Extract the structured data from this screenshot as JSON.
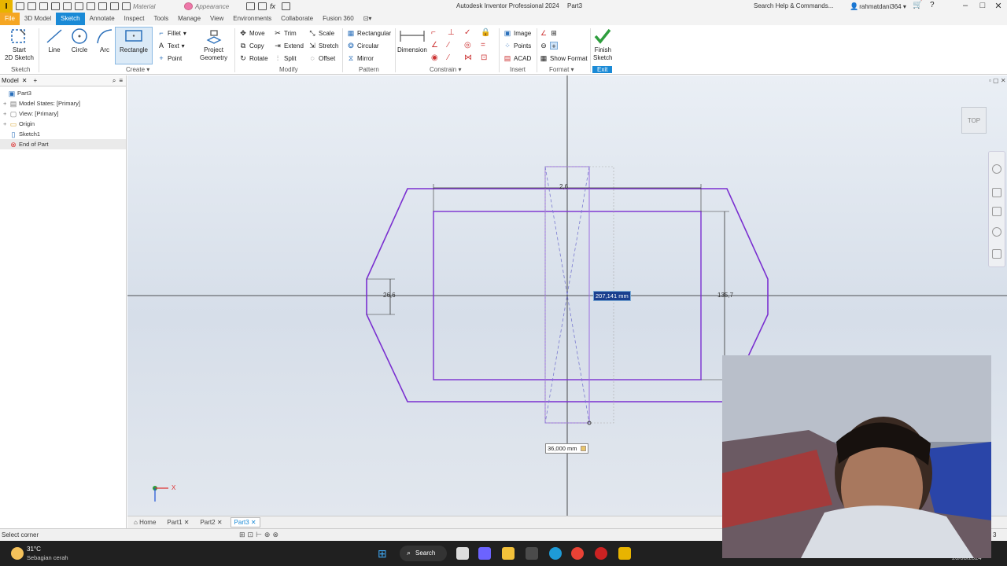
{
  "app": {
    "title": "Autodesk Inventor Professional 2024",
    "doc": "Part3",
    "logo": "I",
    "search_placeholder": "Search Help & Commands...",
    "user": "rahmatdani364",
    "material": "Material",
    "appearance": "Appearance"
  },
  "menu_tabs": [
    "File",
    "3D Model",
    "Sketch",
    "Annotate",
    "Inspect",
    "Tools",
    "Manage",
    "View",
    "Environments",
    "Collaborate",
    "Fusion 360"
  ],
  "ribbon": {
    "start_sketch": "Start\n2D Sketch",
    "line": "Line",
    "circle": "Circle",
    "arc": "Arc",
    "rectangle": "Rectangle",
    "fillet": "Fillet",
    "text": "Text",
    "point": "Point",
    "project_geometry": "Project\nGeometry",
    "move": "Move",
    "copy": "Copy",
    "rotate": "Rotate",
    "trim": "Trim",
    "extend": "Extend",
    "split": "Split",
    "scale": "Scale",
    "stretch": "Stretch",
    "offset": "Offset",
    "rectangular": "Rectangular",
    "circular": "Circular",
    "mirror": "Mirror",
    "dimension": "Dimension",
    "image": "Image",
    "points": "Points",
    "acad": "ACAD",
    "show_format": "Show Format",
    "finish_sketch": "Finish\nSketch",
    "groups": {
      "sketch": "Sketch",
      "create": "Create ▾",
      "modify": "Modify",
      "pattern": "Pattern",
      "constrain": "Constrain ▾",
      "insert": "Insert",
      "format": "Format ▾",
      "exit": "Exit"
    }
  },
  "browser": {
    "tab": "Model",
    "nodes": [
      "Part3",
      "Model States: [Primary]",
      "View: [Primary]",
      "Origin",
      "Sketch1",
      "End of Part"
    ]
  },
  "canvas": {
    "dim_top": "2,6",
    "dim_left": "26,6",
    "dim_right": "135,7",
    "input_value": "207,141 mm",
    "input_width": "36,000 mm",
    "view_cube": "TOP",
    "axis_x": "X"
  },
  "doc_tabs": [
    "Home",
    "Part1",
    "Part2",
    "Part3"
  ],
  "status": {
    "text": "Select corner",
    "count": "3"
  },
  "taskbar": {
    "temp": "31°C",
    "weather": "Sebagian cerah",
    "search": "Search",
    "date": "20/08/2024"
  },
  "colors": {
    "accent": "#1a8ad6",
    "file_tab": "#f5a623",
    "sketch_line": "#7a2fd0",
    "finish_green": "#2e9e3e"
  }
}
